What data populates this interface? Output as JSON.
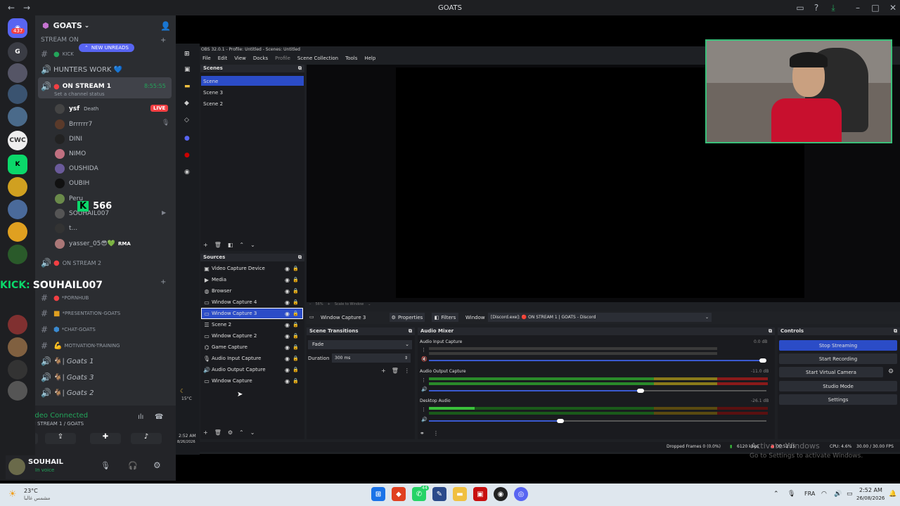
{
  "titlebar": {
    "title": "GOATS"
  },
  "rail": {
    "badge": "437"
  },
  "server": {
    "name": "GOATS"
  },
  "channels": {
    "stream_on": "STREAM ON",
    "new_unreads": "NEW UNREADS",
    "kick": "KICK",
    "hunters_work": "HUNTERS WORK 💙",
    "on_stream_1": "ON STREAM 1",
    "on_stream_1_time": "8:55:55",
    "set_status": "Set a channel status",
    "on_stream_2": "ON STREAM 2",
    "pornhub": "*PORNHUB",
    "presentation": "*PRESENTATION-GOATS",
    "chat": "*CHAT-GOATS",
    "motivation": "MOTIVATION-TRAINING",
    "goats1": "Goats 1",
    "goats3": "Goats 3",
    "goats2": "Goats 2"
  },
  "users": [
    {
      "name": "ysf",
      "extra": "Death",
      "badge": "LIVE"
    },
    {
      "name": "Brrrrrr7"
    },
    {
      "name": "DINI"
    },
    {
      "name": "NIMO"
    },
    {
      "name": "OUSHIDA"
    },
    {
      "name": "OUBIH"
    },
    {
      "name": "Peru"
    },
    {
      "name": "SOUHAIL007"
    },
    {
      "name": "t..."
    },
    {
      "name": "yasser_05😎💚",
      "extra": "RMA"
    }
  ],
  "overlay": {
    "kick_count": "566",
    "kick_name": "SOUHAIL007",
    "kick_label": "KICK:"
  },
  "voice": {
    "status": "Video Connected",
    "channel": "ON STREAM 1 / GOATS"
  },
  "user": {
    "name": "SOUHAIL",
    "status": "In voice"
  },
  "obs": {
    "title": "OBS 32.0.1 - Profile: Untitled - Scenes: Untitled",
    "menu": [
      "File",
      "Edit",
      "View",
      "Docks",
      "Profile",
      "Scene Collection",
      "Tools",
      "Help"
    ],
    "scenes_header": "Scenes",
    "scenes": [
      "Scene",
      "Scene 3",
      "Scene 2"
    ],
    "sources_header": "Sources",
    "sources": [
      "Video Capture Device",
      "Media",
      "Browser",
      "Window Capture 4",
      "Window Capture 3",
      "Scene 2",
      "Window Capture 2",
      "Game Capture",
      "Audio Input Capture",
      "Audio Output Capture",
      "Window Capture"
    ],
    "selected_source": "Window Capture 3",
    "properties": "Properties",
    "filters": "Filters",
    "window_label": "Window",
    "window_value": "[Discord.exe]: 🔴 ON STREAM 1 | GOATS - Discord",
    "zoom": "56%",
    "scale": "Scale to Window",
    "transitions_header": "Scene Transitions",
    "transition": "Fade",
    "duration_label": "Duration",
    "duration": "300 ms",
    "mixer_header": "Audio Mixer",
    "mixer": [
      {
        "name": "Audio Input Capture",
        "db": "0.0 dB"
      },
      {
        "name": "Audio Output Capture",
        "db": "-11.0 dB"
      },
      {
        "name": "Desktop Audio",
        "db": "-26.1 dB"
      }
    ],
    "controls_header": "Controls",
    "controls": [
      "Stop Streaming",
      "Start Recording",
      "Start Virtual Camera",
      "Studio Mode",
      "Settings"
    ],
    "status": {
      "dropped": "Dropped Frames 0 (0.0%)",
      "kbps": "6120 kbps",
      "time": "00:52:15",
      "cpu": "CPU: 4.6%",
      "fps": "30.00 / 30.00 FPS"
    }
  },
  "obs_left": {
    "temp": "15°C",
    "time": "2:52 AM",
    "date": "8/26/2026"
  },
  "activate": {
    "line1": "Activate Windows",
    "line2": "Go to Settings to activate Windows."
  },
  "taskbar": {
    "temp": "23°C",
    "weather": "مشمس غالبا",
    "lang": "FRA",
    "time": "2:52 AM",
    "date": "26/08/2026",
    "whatsapp_badge": "44"
  }
}
